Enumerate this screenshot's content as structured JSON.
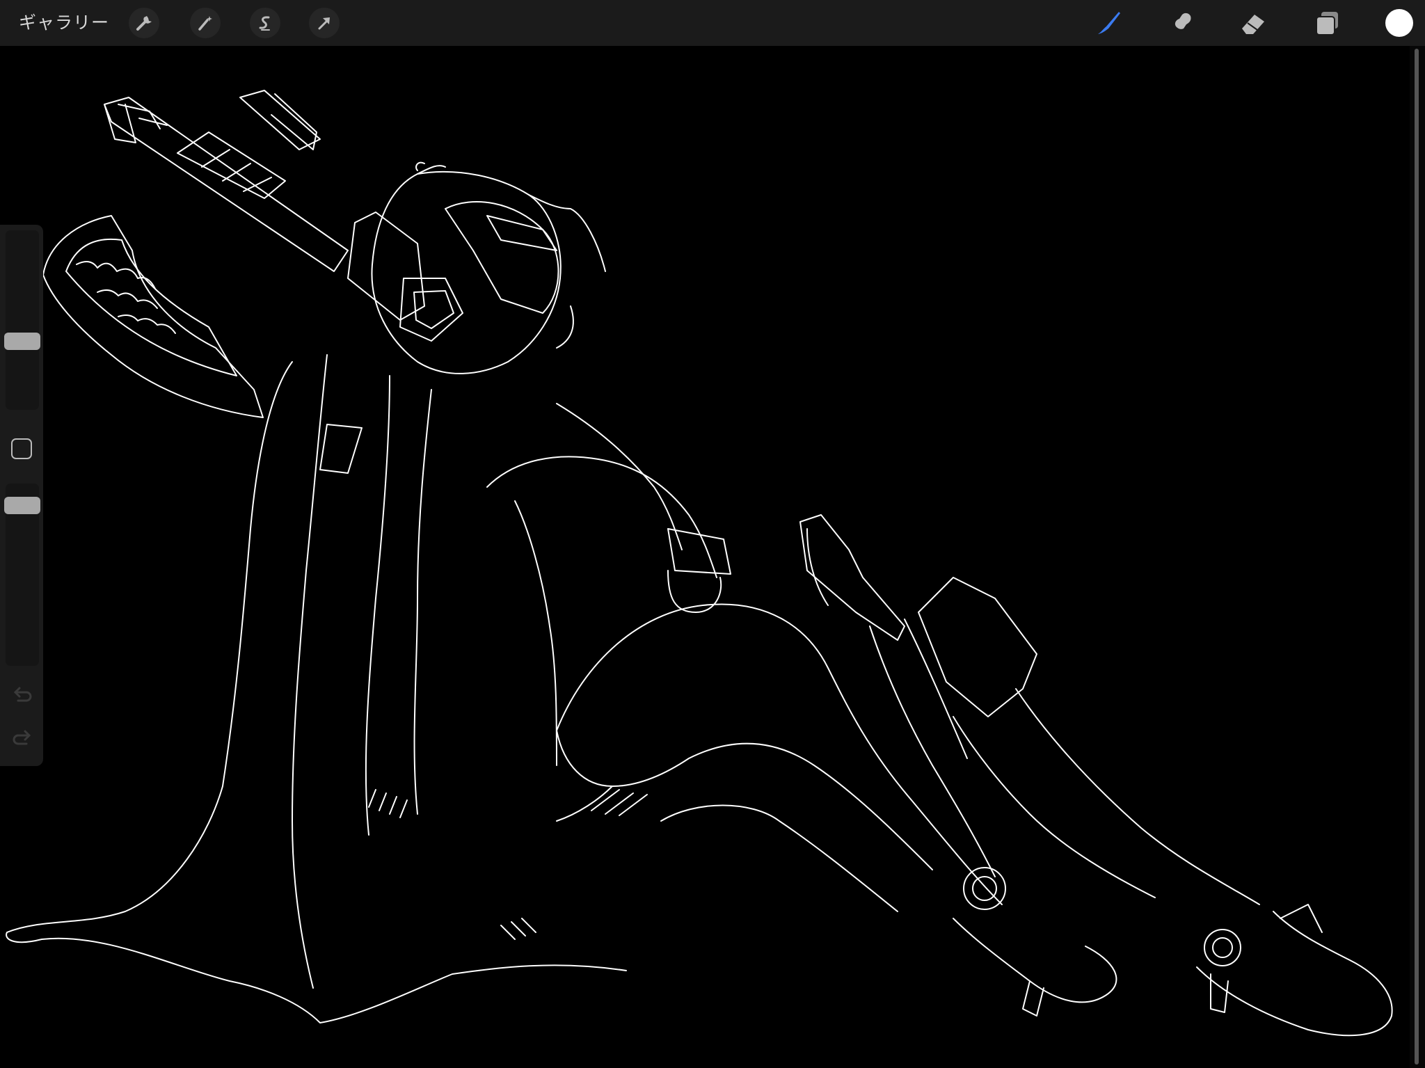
{
  "topbar": {
    "gallery_label": "ギャラリー",
    "left_tools": [
      "wrench-icon",
      "magic-wand-icon",
      "selection-s-icon",
      "transform-arrow-icon"
    ],
    "right_tools": [
      "brush-icon",
      "smudge-icon",
      "eraser-icon",
      "layers-icon"
    ],
    "active_tool": "brush-icon",
    "active_color": "#3b7bf0",
    "current_color": "#ffffff"
  },
  "sidebar": {
    "brush_size_level": 0.37,
    "opacity_level": 0.08,
    "tools": [
      "modify-square-icon",
      "undo-icon",
      "redo-icon"
    ]
  },
  "canvas": {
    "background": "#000000",
    "stroke_color": "#ffffff",
    "subject": "line-art"
  }
}
